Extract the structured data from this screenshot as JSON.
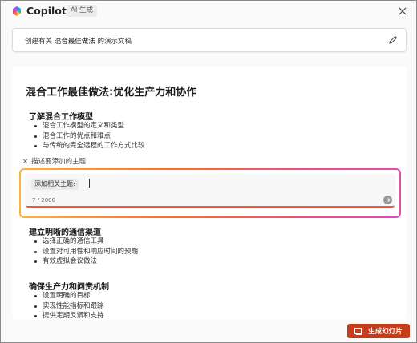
{
  "app": {
    "title": "Copilot",
    "badge": "AI 生成",
    "close_icon": "close-icon",
    "logo_icon": "copilot-logo-icon"
  },
  "prompt": {
    "prefix": "创建有关",
    "topic": "混合最佳做法",
    "suffix": "的演示文稿",
    "edit_icon": "pencil-icon"
  },
  "document": {
    "title": "混合工作最佳做法:优化生产力和协作",
    "sections": [
      {
        "heading": "了解混合工作模型",
        "bullets": [
          "混合工作模型的定义和类型",
          "混合工作的优点和难点",
          "与传统的完全远程的工作方式比较"
        ]
      },
      {
        "heading": "建立明晰的通信渠道",
        "bullets": [
          "选择正确的通信工具",
          "设置对可用性和响应时间的预期",
          "有效虚拟会议做法"
        ]
      },
      {
        "heading": "确保生产力和问责机制",
        "bullets": [
          "设置明确的目标",
          "实现性能指标和跟踪",
          "提供定期反馈和支持"
        ]
      }
    ]
  },
  "add_topic": {
    "hint": "描述要添加的主题",
    "label": "添加相关主题:",
    "counter": "7 / 2000",
    "send_icon": "send-arrow-icon"
  },
  "footer": {
    "generate_label": "生成幻灯片",
    "generate_icon": "slides-icon"
  },
  "colors": {
    "accent": "#c43e1c",
    "gradient_start": "#ffb33a",
    "gradient_end": "#e04bb5"
  }
}
